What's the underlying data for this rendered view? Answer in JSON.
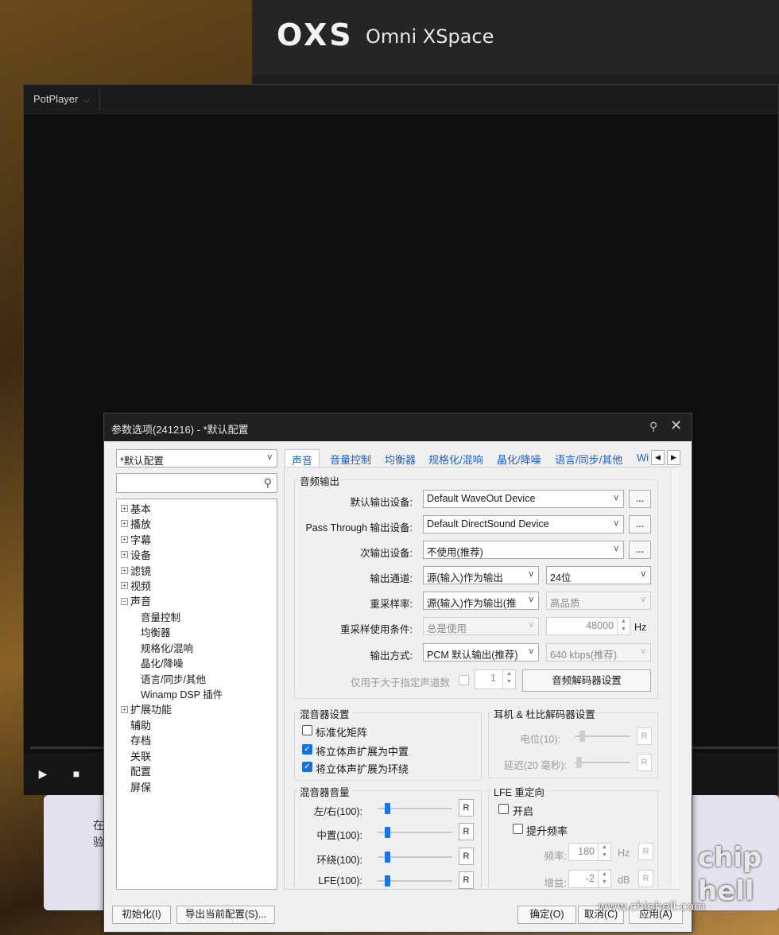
{
  "oxs": {
    "logo_mark": "OXS",
    "logo_text": "Omni XSpace"
  },
  "potplayer": {
    "title": "PotPlayer",
    "title_caret": "⌵",
    "play_icon": "▶",
    "stop_icon": "■"
  },
  "background_card": {
    "line1": "在",
    "line2": "验"
  },
  "dialog": {
    "title": "参数选项(241216) - *默认配置",
    "profile_select": "*默认配置",
    "search_placeholder": "",
    "tree": {
      "basic": "基本",
      "playback": "播放",
      "subtitle": "字幕",
      "device": "设备",
      "filter": "滤镜",
      "video": "视频",
      "audio": "声音",
      "audio_children": [
        "音量控制",
        "均衡器",
        "规格化/混响",
        "晶化/降噪",
        "语言/同步/其他",
        "Winamp DSP 插件"
      ],
      "extensions": "扩展功能",
      "assist": "辅助",
      "archive": "存档",
      "assoc": "关联",
      "config": "配置",
      "screensaver": "屏保"
    },
    "tabs": [
      "声音",
      "音量控制",
      "均衡器",
      "规格化/混响",
      "晶化/降噪",
      "语言/同步/其他",
      "Wi"
    ],
    "audio_output": {
      "group_title": "音频输出",
      "default_device_label": "默认输出设备:",
      "default_device_value": "Default WaveOut Device",
      "passthrough_label": "Pass Through 输出设备:",
      "passthrough_value": "Default DirectSound Device",
      "secondary_label": "次输出设备:",
      "secondary_value": "不使用(推荐)",
      "channel_label": "输出通道:",
      "channel_value": "源(输入)作为输出",
      "bitdepth_value": "24位",
      "resample_label": "重采样率:",
      "resample_value": "源(输入)作为输出(推",
      "quality_value": "高品质",
      "resample_cond_label": "重采样使用条件:",
      "resample_cond_value": "总是使用",
      "samplerate_value": "48000",
      "samplerate_unit": "Hz",
      "output_mode_label": "输出方式:",
      "output_mode_value": "PCM 默认输出(推荐)",
      "bitrate_value": "640 kbps(推荐)",
      "channels_only_label": "仅用于大于指定声道数",
      "channels_only_value": "1",
      "decoder_btn": "音频解码器设置",
      "more_btn": "..."
    },
    "mixer": {
      "group_title": "混音器设置",
      "normalize_matrix": "标准化矩阵",
      "stereo_center": "将立体声扩展为中置",
      "stereo_surround": "将立体声扩展为环绕"
    },
    "headphone": {
      "group_title": "耳机 & 杜比解码器设置",
      "level_label": "电位(10):",
      "delay_label": "延迟(20 毫秒):",
      "reset": "R"
    },
    "mixer_volume": {
      "group_title": "混音器音量",
      "rows": [
        {
          "label": "左/右(100):",
          "value": 100
        },
        {
          "label": "中置(100):",
          "value": 100
        },
        {
          "label": "环绕(100):",
          "value": 100
        },
        {
          "label": "LFE(100):",
          "value": 100
        }
      ],
      "reset": "R"
    },
    "lfe": {
      "group_title": "LFE 重定向",
      "enable": "开启",
      "boost": "提升频率",
      "freq_label": "频率:",
      "freq_value": "180",
      "freq_unit": "Hz",
      "gain_label": "增益:",
      "gain_value": "-2",
      "gain_unit": "dB",
      "reset": "R"
    },
    "footer": {
      "init_btn": "初始化(I)",
      "export_btn": "导出当前配置(S)...",
      "ok_btn": "确定(O)",
      "cancel_btn": "取消(C)",
      "apply_btn": "应用(A)"
    },
    "pin_icon": "📌",
    "close_icon": "✕"
  },
  "watermark": {
    "site": "www.chiphell.com",
    "logo_line1": "chip",
    "logo_line2": "hell"
  },
  "colors": {
    "accent": "#1a73e8",
    "dialog_title_bg": "#202020",
    "tab_text": "#1f5fbf"
  }
}
